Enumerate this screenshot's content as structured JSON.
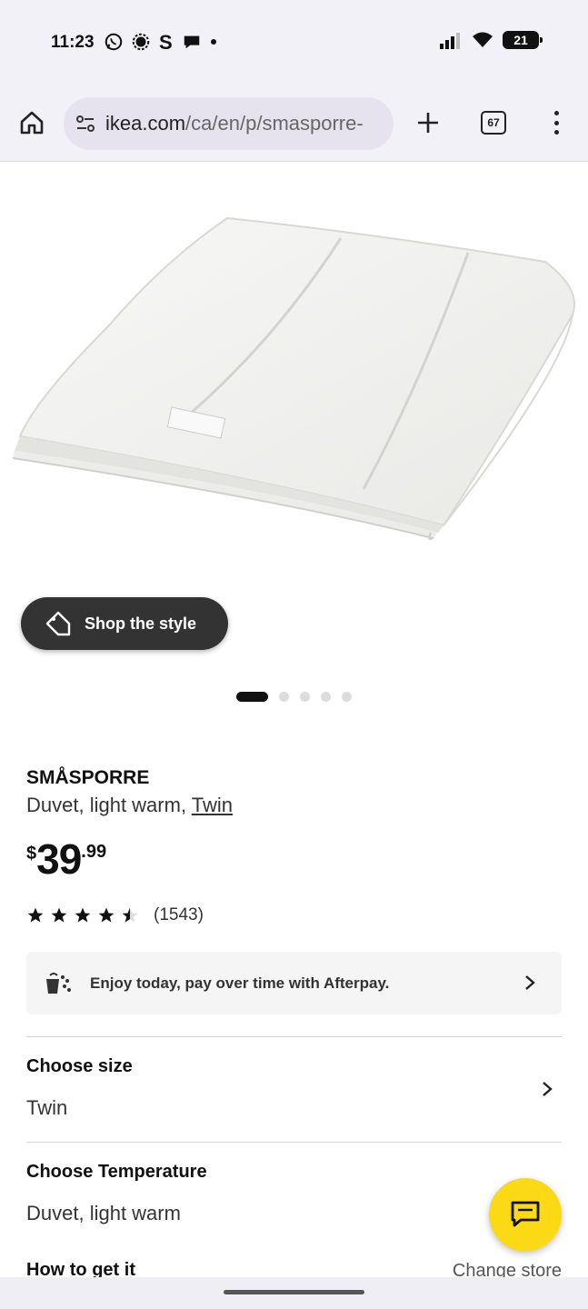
{
  "status_bar": {
    "time": "11:23",
    "battery": "21",
    "left_icons": [
      "whatsapp-icon",
      "signal-app-icon",
      "s-app-icon",
      "chat-bubble-icon",
      "dot-icon"
    ],
    "right_icons": [
      "cellular-signal-icon",
      "wifi-icon",
      "battery-icon"
    ]
  },
  "browser": {
    "url_host": "ikea.com",
    "url_path": "/ca/en/p/smasporre-",
    "tab_count": "67",
    "icons": [
      "home-icon",
      "site-settings-icon",
      "new-tab-icon",
      "tabs-icon",
      "more-menu-icon"
    ]
  },
  "gallery": {
    "shop_the_style": "Shop the style",
    "dot_count": 5,
    "active_dot": 0
  },
  "product": {
    "name": "SMÅSPORRE",
    "description": "Duvet, light warm, ",
    "size_link": "Twin",
    "price_currency": "$",
    "price_int": "39",
    "price_dec": ".99",
    "rating": 4.5,
    "rating_max": 5,
    "review_count": "(1543)"
  },
  "afterpay": {
    "text": "Enjoy today, pay over time with Afterpay."
  },
  "options": {
    "size_title": "Choose size",
    "size_value": "Twin",
    "temp_title": "Choose Temperature",
    "temp_value": "Duvet, light warm"
  },
  "availability": {
    "title": "How to get it",
    "change_store": "Change store"
  },
  "colors": {
    "chat_fab": "#fbd914",
    "shop_button": "#333333",
    "chrome_bg": "#f3f1f8"
  }
}
